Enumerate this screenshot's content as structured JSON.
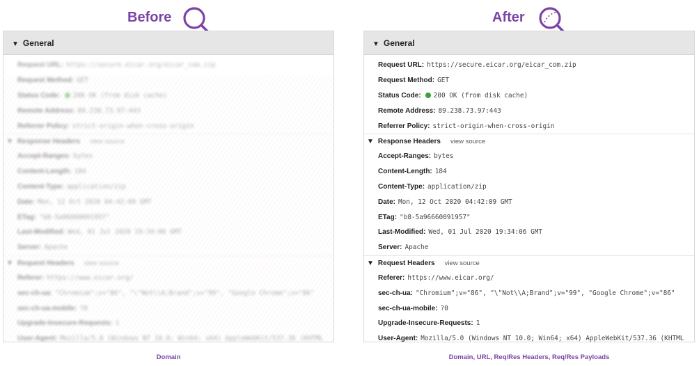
{
  "before": {
    "title": "Before",
    "section": "General",
    "request_url_label": "Request URL:",
    "request_url_value": "https://secure.eicar.org/eicar_com.zip",
    "caption": "Domain"
  },
  "after": {
    "title": "After",
    "section": "General",
    "general": [
      {
        "label": "Request URL:",
        "value": "https://secure.eicar.org/eicar_com.zip"
      },
      {
        "label": "Request Method:",
        "value": "GET"
      },
      {
        "label": "Status Code:",
        "value": "200 OK (from disk cache)"
      },
      {
        "label": "Remote Address:",
        "value": "89.238.73.97:443"
      },
      {
        "label": "Referrer Policy:",
        "value": "strict-origin-when-cross-origin"
      }
    ],
    "response_headers_label": "Response Headers",
    "response_view_source": "view source",
    "response_headers": [
      {
        "label": "Accept-Ranges:",
        "value": "bytes"
      },
      {
        "label": "Content-Length:",
        "value": "184"
      },
      {
        "label": "Content-Type:",
        "value": "application/zip"
      },
      {
        "label": "Date:",
        "value": "Mon, 12 Oct 2020 04:42:09 GMT"
      },
      {
        "label": "ETag:",
        "value": "\"b8-5a96660091957\""
      },
      {
        "label": "Last-Modified:",
        "value": "Wed, 01 Jul 2020 19:34:06 GMT"
      },
      {
        "label": "Server:",
        "value": "Apache"
      }
    ],
    "request_headers_label": "Request Headers",
    "request_view_source": "view source",
    "request_headers": [
      {
        "label": "Referer:",
        "value": "https://www.eicar.org/"
      },
      {
        "label": "sec-ch-ua:",
        "value": "\"Chromium\";v=\"86\", \"\\\"Not\\\\A;Brand\";v=\"99\", \"Google Chrome\";v=\"86\""
      },
      {
        "label": "sec-ch-ua-mobile:",
        "value": "?0"
      },
      {
        "label": "Upgrade-Insecure-Requests:",
        "value": "1"
      },
      {
        "label": "User-Agent:",
        "value": "Mozilla/5.0 (Windows NT 10.0; Win64; x64) AppleWebKit/537.36 (KHTML"
      }
    ],
    "caption": "Domain, URL, Req/Res Headers, Req/Res Payloads"
  },
  "colors": {
    "accent": "#7a43a6",
    "status_dot": "#3aa13a",
    "header_bg": "#e6e6e6"
  }
}
